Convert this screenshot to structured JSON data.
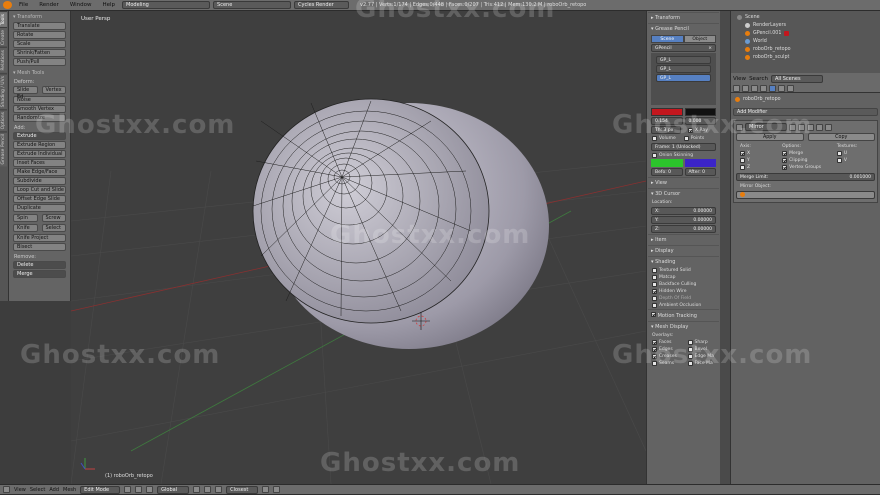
{
  "top_menu": {
    "items": [
      "File",
      "Render",
      "Window",
      "Help"
    ],
    "layout": "Modeling",
    "scene": "Scene",
    "engine": "Cycles Render",
    "info": "v2.77 | Verts:1/174 | Edges:0/448 | Faces:0/207 | Tris:412 | Mem:130.2 M | roboOrb_retopo"
  },
  "tool_tabs": [
    "Tools",
    "Create",
    "Relations",
    "Shading / UVs",
    "Options",
    "Grease Pencil"
  ],
  "toolshelf": {
    "transform_header": "▾ Transform",
    "transform_buttons": [
      "Translate",
      "Rotate",
      "Scale",
      "Shrink/Fatten",
      "Push/Pull"
    ],
    "mesh_tools_header": "▾ Mesh Tools",
    "deform_label": "Deform:",
    "slide": [
      "Slide Ed",
      "Vertex"
    ],
    "deform_buttons": [
      "Noise",
      "Smooth Vertex",
      "Randomize"
    ],
    "add_label": "Add:",
    "extrude": "Extrude",
    "add_buttons": [
      "Extrude Region",
      "Extrude Individual",
      "Inset Faces",
      "Make Edge/Face",
      "Subdivide",
      "Loop Cut and Slide",
      "Offset Edge Slide",
      "Duplicate"
    ],
    "spin_screw": [
      "Spin",
      "Screw"
    ],
    "knife_select": [
      "Knife",
      "Select"
    ],
    "more_buttons": [
      "Knife Project",
      "Bisect"
    ],
    "remove_label": "Remove:",
    "delete": "Delete",
    "merge": "Merge"
  },
  "viewport": {
    "title": "User Persp",
    "object_label": "(1) roboOrb_retopo"
  },
  "npanel": {
    "transform": "▸ Transform",
    "grease_header": "▾ Grease Pencil",
    "scene_tab": "Scene",
    "object_tab": "Object",
    "gpencil_name": "GPencil",
    "layers": [
      "GP_L",
      "GP_L",
      "GP_L"
    ],
    "val_a": "0.154",
    "val_b": "0.000",
    "thickness": "Th: 3 px",
    "xray": "X Ray",
    "volume": "Volume",
    "points": "Points",
    "frame": "Frame: 1 (Unlocked)",
    "onion": "Onion Skinning",
    "before": "Befo: 0",
    "after": "After: 0",
    "view": "▸ View",
    "cursor_header": "▾ 3D Cursor",
    "location": "Location:",
    "cx": "X:",
    "cy": "Y:",
    "cz": "Z:",
    "cx_val": "0.00000",
    "cy_val": "0.00000",
    "cz_val": "0.00000",
    "item": "▸ Item",
    "display": "▸ Display",
    "shading_header": "▾ Shading",
    "shading_opts": [
      "Textured Solid",
      "Matcap",
      "Backface Culling",
      "Hidden Wire",
      "Depth Of Field",
      "Ambient Occlusion"
    ],
    "motion_tracking": "Motion Tracking",
    "mesh_display": "▾ Mesh Display",
    "overlays": "Overlays:",
    "ov_left": [
      "Faces",
      "Edges",
      "Creases",
      "Seams"
    ],
    "ov_right": [
      "Sharp",
      "Bevel",
      "Edge Ma",
      "Face Ma"
    ]
  },
  "outliner": {
    "rows": [
      "Scene",
      "RenderLayers",
      "GPencil.001",
      "World",
      "roboOrb_retopo",
      "roboOrb_sculpt"
    ]
  },
  "properties": {
    "view": "View",
    "search": "Search",
    "scope": "All Scenes",
    "breadcrumb": "roboOrb_retopo",
    "add_modifier": "Add Modifier",
    "modifier_name": "Mirror",
    "apply": "Apply",
    "copy": "Copy",
    "axis_label": "Axis:",
    "options_label": "Options:",
    "textures_label": "Textures:",
    "axes": [
      "X",
      "Y",
      "Z"
    ],
    "options": [
      "Merge",
      "Clipping",
      "Vertex Groups"
    ],
    "textures": [
      "U",
      "V"
    ],
    "merge_limit": "Merge Limit:",
    "merge_limit_val": "0.001000",
    "mirror_object": "Mirror Object:"
  },
  "bottom_bar": {
    "items": [
      "View",
      "Select",
      "Add",
      "Mesh"
    ],
    "mode": "Edit Mode",
    "orientation": "Global",
    "snap": "Closest"
  },
  "watermark": "Ghostxx.com",
  "colors": {
    "accent": "#5680c2",
    "orange": "#e87d0d",
    "red_swatch": "#c3171e",
    "green_swatch": "#2bc52b",
    "violet_swatch": "#3b24c8"
  }
}
